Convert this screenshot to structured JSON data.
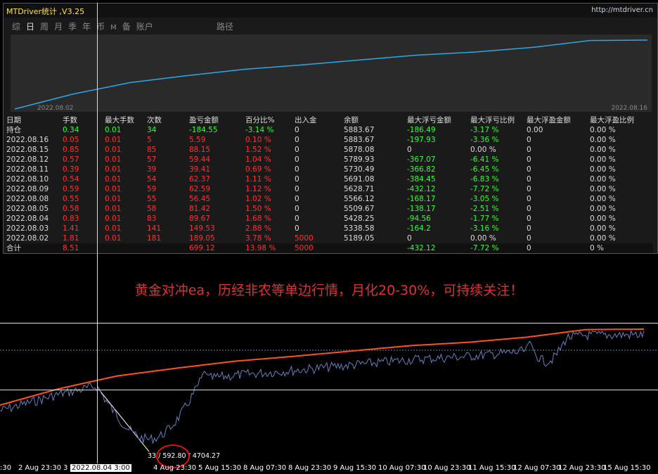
{
  "window": {
    "title": "MTDriver统计 ,V3.25",
    "url": "http://mtdriver.cn"
  },
  "tabs": [
    "综",
    "日",
    "周",
    "月",
    "季",
    "年",
    "币",
    "M",
    "备",
    "账户"
  ],
  "active_tab": "日",
  "path_label": "路径",
  "equity_chart": {
    "start_date": "2022.08.02",
    "end_date": "2022.08.16",
    "line_color": "#2aa8e8",
    "values": [
      5000,
      5189.05,
      5338.58,
      5428.25,
      5509.67,
      5566.12,
      5628.71,
      5691.08,
      5730.49,
      5789.93,
      5878.08,
      5883.67
    ]
  },
  "table": {
    "headers": [
      "日期",
      "手数",
      "最大手数",
      "次数",
      "盈亏金额",
      "百分比%",
      "出入金",
      "余额",
      "最大浮亏金额",
      "最大浮亏比例",
      "最大浮盈金额",
      "最大浮盈比例"
    ],
    "holding": [
      "持仓",
      "0.34",
      "0.01",
      "34",
      "-184.55",
      "-3.14 %",
      "0",
      "5883.67",
      "-186.49",
      "-3.17 %",
      "0.00",
      "0.00 %"
    ],
    "rows": [
      [
        "2022.08.16",
        "0.05",
        "0.01",
        "5",
        "5.59",
        "0.10 %",
        "0",
        "5883.67",
        "-197.93",
        "-3.36 %",
        "0",
        "0.00 %"
      ],
      [
        "2022.08.15",
        "0.85",
        "0.01",
        "85",
        "88.15",
        "1.52 %",
        "0",
        "5878.08",
        "0",
        "0.00 %",
        "0",
        "0.00 %"
      ],
      [
        "2022.08.12",
        "0.57",
        "0.01",
        "57",
        "59.44",
        "1.04 %",
        "0",
        "5789.93",
        "-367.07",
        "-6.41 %",
        "0",
        "0.00 %"
      ],
      [
        "2022.08.11",
        "0.39",
        "0.01",
        "39",
        "39.41",
        "0.69 %",
        "0",
        "5730.49",
        "-366.82",
        "-6.45 %",
        "0",
        "0.00 %"
      ],
      [
        "2022.08.10",
        "0.54",
        "0.01",
        "54",
        "62.37",
        "1.11 %",
        "0",
        "5691.08",
        "-384.45",
        "-6.83 %",
        "0",
        "0.00 %"
      ],
      [
        "2022.08.09",
        "0.59",
        "0.01",
        "59",
        "62.59",
        "1.12 %",
        "0",
        "5628.71",
        "-432.12",
        "-7.72 %",
        "0",
        "0.00 %"
      ],
      [
        "2022.08.08",
        "0.55",
        "0.01",
        "55",
        "56.45",
        "1.02 %",
        "0",
        "5566.12",
        "-168.17",
        "-3.05 %",
        "0",
        "0.00 %"
      ],
      [
        "2022.08.05",
        "0.58",
        "0.01",
        "58",
        "81.42",
        "1.50 %",
        "0",
        "5509.67",
        "-138.17",
        "-2.51 %",
        "0",
        "0.00 %"
      ],
      [
        "2022.08.04",
        "0.83",
        "0.01",
        "83",
        "89.67",
        "1.68 %",
        "0",
        "5428.25",
        "-94.56",
        "-1.77 %",
        "0",
        "0.00 %"
      ],
      [
        "2022.08.03",
        "1.41",
        "0.01",
        "141",
        "149.53",
        "2.88 %",
        "0",
        "5338.58",
        "-164.2",
        "-3.16 %",
        "0",
        "0.00 %"
      ],
      [
        "2022.08.02",
        "1.81",
        "0.01",
        "181",
        "189.05",
        "3.78 %",
        "5000",
        "5189.05",
        "0",
        "0.00 %",
        "0",
        "0.00 %"
      ]
    ],
    "total": [
      "合计",
      "8.51",
      "",
      "",
      "699.12",
      "13.98 %",
      "5000",
      "",
      "-432.12",
      "-7.72 %",
      "0",
      "0 %"
    ]
  },
  "slogan": "黄金对冲ea，历经非农等单边行情，月化20-30%，可持续关注！",
  "bottom_chart": {
    "balance_color": "#ff5020",
    "equity_color": "#6a7fbf",
    "readout": [
      "33",
      "592.80",
      "4704.27"
    ],
    "cursor_date": "2022.08.04 3:00",
    "x_labels": [
      ":30",
      "2 Aug 23:30",
      "3",
      "4 Aug 23:30",
      "5 Aug 15:30",
      "8 Aug 07:30",
      "8 Aug 23:30",
      "9 Aug 15:30",
      "10 Aug 07:30",
      "10 Aug 23:30",
      "11 Aug 15:30",
      "12 Aug 07:30",
      "12 Aug 23:30",
      "15 Aug 15:30"
    ]
  }
}
